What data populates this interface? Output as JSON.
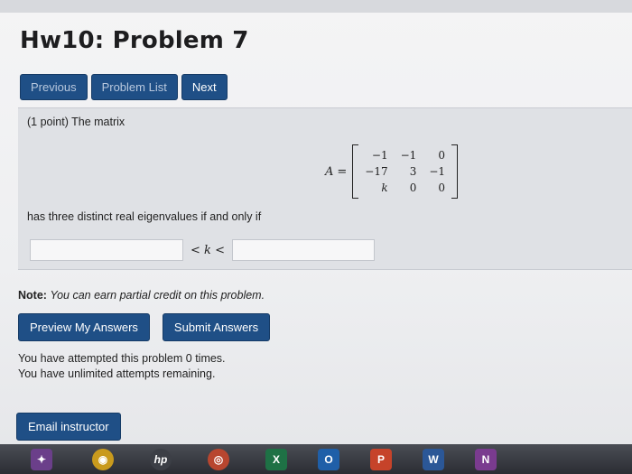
{
  "page": {
    "title": "Hw10: Problem 7"
  },
  "nav": {
    "previous_label": "Previous",
    "problem_list_label": "Problem List",
    "next_label": "Next"
  },
  "problem": {
    "prompt": "(1 point) The matrix",
    "matrix_label": "A",
    "matrix_equals": "=",
    "matrix_rows": [
      [
        "−1",
        "−1",
        "0"
      ],
      [
        "−17",
        "3",
        "−1"
      ],
      [
        "k",
        "0",
        "0"
      ]
    ],
    "condition": "has three distinct real eigenvalues if and only if",
    "answer": {
      "lower_value": "",
      "upper_value": "",
      "lt1": "<",
      "variable": "k",
      "lt2": "<"
    }
  },
  "note": {
    "label": "Note:",
    "text": "You can earn partial credit on this problem."
  },
  "actions": {
    "preview_label": "Preview My Answers",
    "submit_label": "Submit Answers"
  },
  "status": {
    "attempts": "You have attempted this problem 0 times.",
    "remaining": "You have unlimited attempts remaining."
  },
  "email": {
    "label": "Email instructor"
  },
  "taskbar": {
    "icons": [
      {
        "name": "photos-icon",
        "glyph": "✦",
        "color": "#6b3f8a"
      },
      {
        "name": "chrome-icon",
        "glyph": "◉",
        "color": "#c99a1d"
      },
      {
        "name": "hp-icon",
        "glyph": "hp",
        "color": "#3c3f46"
      },
      {
        "name": "chrome-alt-icon",
        "glyph": "◎",
        "color": "#b8462f"
      },
      {
        "name": "excel-icon",
        "glyph": "X",
        "color": "#1e7145"
      },
      {
        "name": "outlook-icon",
        "glyph": "O",
        "color": "#1f5fa8"
      },
      {
        "name": "powerpoint-icon",
        "glyph": "P",
        "color": "#c6432a"
      },
      {
        "name": "word-icon",
        "glyph": "W",
        "color": "#2b5797"
      },
      {
        "name": "onenote-icon",
        "glyph": "N",
        "color": "#7a3b8f"
      }
    ]
  }
}
